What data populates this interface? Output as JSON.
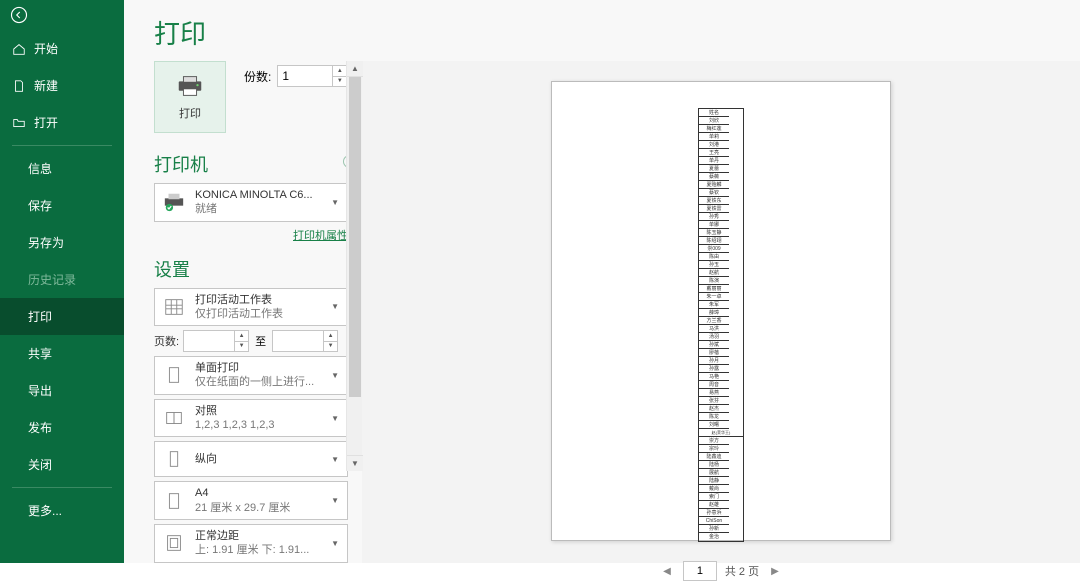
{
  "page_title": "打印",
  "sidebar": {
    "home": "开始",
    "new": "新建",
    "open": "打开",
    "info": "信息",
    "save": "保存",
    "saveas": "另存为",
    "history": "历史记录",
    "print": "打印",
    "share": "共享",
    "export": "导出",
    "publish": "发布",
    "close": "关闭",
    "more": "更多..."
  },
  "print_btn_label": "打印",
  "copies_label": "份数:",
  "copies_value": "1",
  "printer_section": "打印机",
  "printer_name": "KONICA MINOLTA C6...",
  "printer_status": "就绪",
  "printer_props": "打印机属性",
  "settings_section": "设置",
  "opt_scope_title": "打印活动工作表",
  "opt_scope_sub": "仅打印活动工作表",
  "pages_label": "页数:",
  "to_label": "至",
  "opt_duplex_title": "单面打印",
  "opt_duplex_sub": "仅在纸面的一侧上进行...",
  "opt_collate_title": "对照",
  "opt_collate_sub": "1,2,3    1,2,3    1,2,3",
  "opt_orient_title": "纵向",
  "opt_orient_sub": "",
  "opt_paper_title": "A4",
  "opt_paper_sub": "21 厘米 x 29.7 厘米",
  "opt_margin_title": "正常边距",
  "opt_margin_sub": "上: 1.91 厘米 下: 1.91...",
  "current_page": "1",
  "page_total_text": "共 2 页",
  "preview_cells": [
    "姓名",
    "刘欣",
    "梅红莲",
    "单莉",
    "刘港",
    "王亮",
    "单丹",
    "夏蕾",
    "蔡薇",
    "夏贻麟",
    "蔡钦",
    "夏铁东",
    "夏铁雷",
    "孙秀",
    "单娜",
    "陈玉静",
    "陈绍翊",
    "崇009",
    "陈由",
    "孙玉",
    "赵航",
    "陈演",
    "戴丽丽",
    "朱一卓",
    "朱军",
    "薛璋",
    "方兰香",
    "马洪",
    "汤羽",
    "孙斌",
    "廖蓓",
    "孙月",
    "孙露",
    "马艳",
    "周音",
    "易燕",
    "张芬",
    "赵杰",
    "陈龙",
    "刘曙",
    "赵(茉华王)",
    "崇方",
    "宗玲",
    "陆鑫迪",
    "陆杨",
    "展航",
    "陆静",
    "戴尚",
    "索门",
    "赵雄",
    "孙意浜",
    "ChiSon",
    "孙新",
    "金治"
  ]
}
